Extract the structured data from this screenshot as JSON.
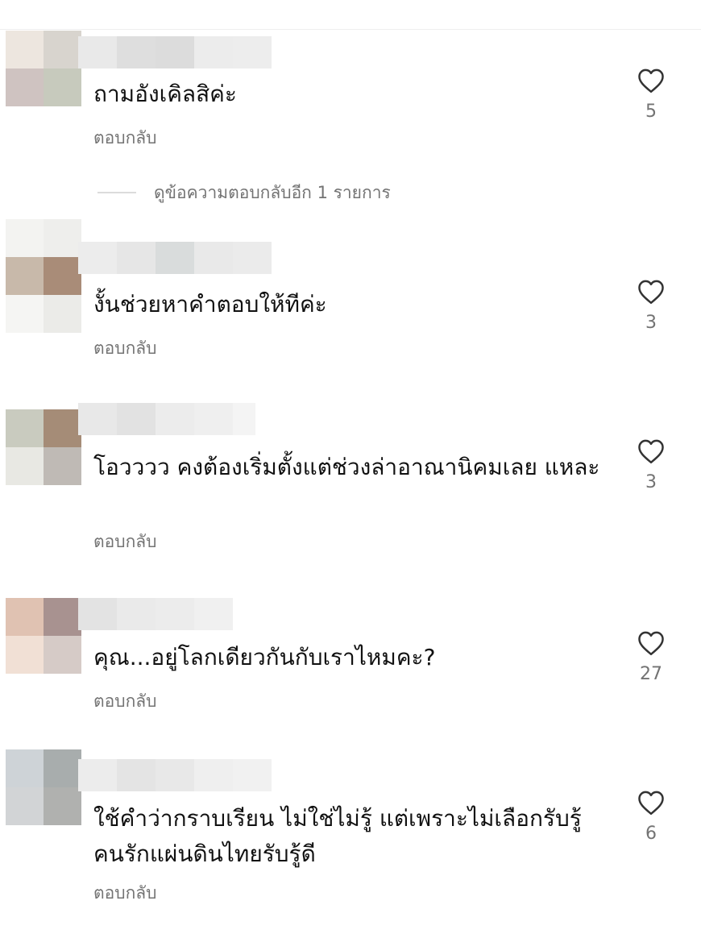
{
  "reply_label": "ตอบกลับ",
  "view_more_replies": "ดูข้อความตอบกลับอีก 1 รายการ",
  "comments": [
    {
      "text": "ถามอังเคิลสิค่ะ",
      "likes": "5"
    },
    {
      "text": "งั้นช่วยหาคำตอบให้ทีค่ะ",
      "likes": "3"
    },
    {
      "text": "โอวววว คงต้องเริ่มตั้งแต่ช่วงล่าอาณานิคมเลย แหละ",
      "likes": "3"
    },
    {
      "text": "คุณ...อยู่โลกเดียวกันกับเราไหมคะ?",
      "likes": "27"
    },
    {
      "text": "ใช้คำว่ากราบเรียน ไม่ใช่ไม่รู้ แต่เพราะไม่เลือกรับรู้ คนรักแผ่นดินไทยรับรู้ดี",
      "likes": "6"
    }
  ],
  "icons": {
    "like": "heart-outline-icon"
  },
  "colors": {
    "text": "#111111",
    "secondary": "#737373",
    "divider": "#dbdbdb"
  }
}
